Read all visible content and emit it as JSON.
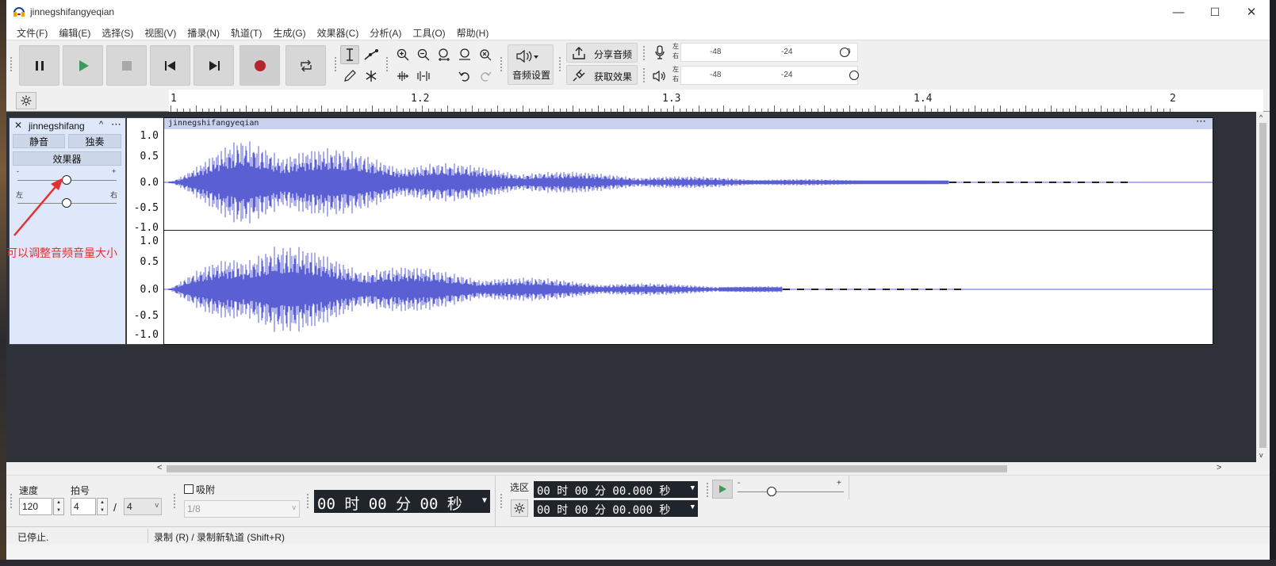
{
  "window": {
    "title": "jinnegshifangyeqian",
    "minimize": "—",
    "maximize": "☐",
    "close": "✕"
  },
  "menu": [
    "文件(F)",
    "编辑(E)",
    "选择(S)",
    "视图(V)",
    "播录(N)",
    "轨道(T)",
    "生成(G)",
    "效果器(C)",
    "分析(A)",
    "工具(O)",
    "帮助(H)"
  ],
  "toolbar": {
    "audio_setup": "音频设置",
    "share_audio": "分享音频",
    "get_effects": "获取效果",
    "meter_labels": [
      "-48",
      "-24",
      "0"
    ],
    "meter_lr": [
      "左",
      "右"
    ]
  },
  "ruler": {
    "labels": [
      "1",
      "1.2",
      "1.3",
      "1.4",
      "2"
    ]
  },
  "track": {
    "name": "jinnegshifang",
    "mute": "静音",
    "solo": "独奏",
    "effects": "效果器",
    "gain_minus": "-",
    "gain_plus": "+",
    "pan_left": "左",
    "pan_right": "右",
    "clip_name": "jinnegshifangyeqian",
    "scale": [
      "1.0",
      "0.5",
      "0.0",
      "-0.5",
      "-1.0"
    ],
    "waveform_color": "#5b5fd4"
  },
  "annotation": {
    "text": "可以调整音频音量大小",
    "color": "#e23030"
  },
  "bottom": {
    "tempo_label": "速度",
    "tempo_value": "120",
    "beats_label": "拍号",
    "beats_value": "4",
    "beats_sep": "/",
    "beats_denominator": "4",
    "snap_label": "吸附",
    "snap_value": "1/8",
    "time_display": "00 时 00 分 00 秒",
    "selection_label": "选区",
    "sel_start": "00 时 00 分 00.000 秒",
    "sel_end": "00 时 00 分 00.000 秒",
    "speed_minus": "-",
    "speed_plus": "+"
  },
  "status": {
    "left": "已停止.",
    "hint": "录制 (R) / 录制新轨道 (Shift+R)"
  }
}
